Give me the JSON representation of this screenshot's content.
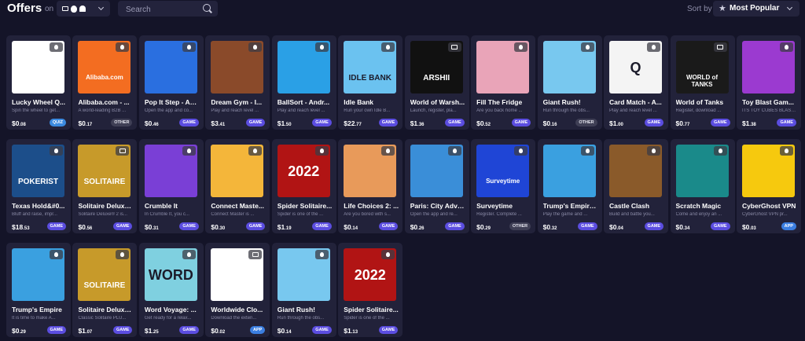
{
  "header": {
    "title": "Offers",
    "on_label": "on",
    "search_placeholder": "Search",
    "sort_label": "Sort by",
    "sort_value": "Most Popular"
  },
  "offers": [
    {
      "name": "Lucky Wheel Q...",
      "desc": "Spin the wheel to get...",
      "price_int": "$0",
      "price_dec": ".08",
      "tag": "QUIZ",
      "platform": "apple",
      "thumb": "lucky-wheel",
      "bg": "#ffffff",
      "thumb_text": ""
    },
    {
      "name": "Alibaba.com - ...",
      "desc": "A world-leading B2B ...",
      "price_int": "$0",
      "price_dec": ".17",
      "tag": "OTHER",
      "platform": "android",
      "thumb": "alibaba",
      "bg": "#f36d21",
      "thumb_text": "Alibaba.com"
    },
    {
      "name": "Pop It Step - An...",
      "desc": "Open the app and co...",
      "price_int": "$0",
      "price_dec": ".46",
      "tag": "GAME",
      "platform": "android",
      "thumb": "pop-it",
      "bg": "#2a6fe0",
      "thumb_text": ""
    },
    {
      "name": "Dream Gym - I...",
      "desc": "Play and reach level ...",
      "price_int": "$3",
      "price_dec": ".41",
      "tag": "GAME",
      "platform": "android",
      "thumb": "dream-gym",
      "bg": "#8a4a2a",
      "thumb_text": ""
    },
    {
      "name": "BallSort - Andr...",
      "desc": "Play and reach level ...",
      "price_int": "$1",
      "price_dec": ".50",
      "tag": "GAME",
      "platform": "android",
      "thumb": "ballsort",
      "bg": "#2aa0e6",
      "thumb_text": ""
    },
    {
      "name": "Idle Bank",
      "desc": "Run your own Idle B...",
      "price_int": "$22",
      "price_dec": ".77",
      "tag": "GAME",
      "platform": "android",
      "thumb": "idle-bank",
      "bg": "#6bc2f0",
      "thumb_text": "IDLE BANK"
    },
    {
      "name": "World of Warsh...",
      "desc": "Launch, register, pla...",
      "price_int": "$1",
      "price_dec": ".36",
      "tag": "GAME",
      "platform": "monitor",
      "thumb": "warships",
      "bg": "#111111",
      "thumb_text": "ARSHII"
    },
    {
      "name": "Fill The Fridge",
      "desc": "Are you back home ...",
      "price_int": "$0",
      "price_dec": ".52",
      "tag": "GAME",
      "platform": "apple",
      "thumb": "fridge",
      "bg": "#e9a4b8",
      "thumb_text": ""
    },
    {
      "name": "Giant Rush!",
      "desc": "Run through the obs...",
      "price_int": "$0",
      "price_dec": ".16",
      "tag": "OTHER",
      "platform": "android",
      "thumb": "giant-rush",
      "bg": "#78c8ef",
      "thumb_text": ""
    },
    {
      "name": "Card Match - A...",
      "desc": "Play and reach level ...",
      "price_int": "$1",
      "price_dec": ".00",
      "tag": "GAME",
      "platform": "android",
      "thumb": "card-match",
      "bg": "#f4f4f4",
      "thumb_text": "Q"
    },
    {
      "name": "World of Tanks",
      "desc": "Register, download ...",
      "price_int": "$0",
      "price_dec": ".77",
      "tag": "GAME",
      "platform": "monitor",
      "thumb": "tanks",
      "bg": "#1a1a1a",
      "thumb_text": "WORLD of TANKS"
    },
    {
      "name": "Toy Blast Gam...",
      "desc": "ITS TOY CUBES BLAST...",
      "price_int": "$1",
      "price_dec": ".38",
      "tag": "GAME",
      "platform": "android",
      "thumb": "toy-blast",
      "bg": "#9b3ad0",
      "thumb_text": ""
    },
    {
      "name": "Texas Hold&#0...",
      "desc": "Bluff and raise, impr...",
      "price_int": "$18",
      "price_dec": ".53",
      "tag": "GAME",
      "platform": "android",
      "thumb": "pokerist",
      "bg": "#1c4e8a",
      "thumb_text": "POKERIST"
    },
    {
      "name": "Solitaire Deluxe...",
      "desc": "Solitaire Deluxe® 2 is...",
      "price_int": "$0",
      "price_dec": ".56",
      "tag": "GAME",
      "platform": "monitor",
      "thumb": "solitaire",
      "bg": "#c79a2a",
      "thumb_text": "SOLITAIRE"
    },
    {
      "name": "Crumble It",
      "desc": "In Crumble It, you c...",
      "price_int": "$0",
      "price_dec": ".31",
      "tag": "GAME",
      "platform": "android",
      "thumb": "crumble",
      "bg": "#7a3fd6",
      "thumb_text": ""
    },
    {
      "name": "Connect Maste...",
      "desc": "Connect Master is ...",
      "price_int": "$0",
      "price_dec": ".30",
      "tag": "GAME",
      "platform": "android",
      "thumb": "connect",
      "bg": "#f4b63a",
      "thumb_text": ""
    },
    {
      "name": "Spider Solitaire...",
      "desc": "Spider is one of the ...",
      "price_int": "$1",
      "price_dec": ".19",
      "tag": "GAME",
      "platform": "android",
      "thumb": "spider",
      "bg": "#b11414",
      "thumb_text": "2022"
    },
    {
      "name": "Life Choices 2: ...",
      "desc": "Are you bored with s...",
      "price_int": "$0",
      "price_dec": ".14",
      "tag": "GAME",
      "platform": "android",
      "thumb": "life-choices",
      "bg": "#e89a5a",
      "thumb_text": ""
    },
    {
      "name": "Paris: City Adve...",
      "desc": "Open the app and re...",
      "price_int": "$0",
      "price_dec": ".26",
      "tag": "GAME",
      "platform": "android",
      "thumb": "paris",
      "bg": "#3a8ed8",
      "thumb_text": ""
    },
    {
      "name": "Surveytime",
      "desc": "Register. Complete ...",
      "price_int": "$0",
      "price_dec": ".29",
      "tag": "OTHER",
      "platform": "apple",
      "thumb": "surveytime",
      "bg": "#1f45d6",
      "thumb_text": "Surveytime"
    },
    {
      "name": "Trump's Empire...",
      "desc": "Play the game and ...",
      "price_int": "$0",
      "price_dec": ".32",
      "tag": "GAME",
      "platform": "android",
      "thumb": "trump",
      "bg": "#3aa0e0",
      "thumb_text": ""
    },
    {
      "name": "Castle Clash",
      "desc": "Build and battle you...",
      "price_int": "$0",
      "price_dec": ".04",
      "tag": "GAME",
      "platform": "android",
      "thumb": "castle",
      "bg": "#8a5a2a",
      "thumb_text": ""
    },
    {
      "name": "Scratch Magic",
      "desc": "Come and enjoy an ...",
      "price_int": "$0",
      "price_dec": ".34",
      "tag": "GAME",
      "platform": "android",
      "thumb": "scratch",
      "bg": "#1a8a8a",
      "thumb_text": ""
    },
    {
      "name": "CyberGhost VPN",
      "desc": "CyberGhost VPN pr...",
      "price_int": "$0",
      "price_dec": ".03",
      "tag": "APP",
      "platform": "apple",
      "thumb": "cyberghost",
      "bg": "#f6c90e",
      "thumb_text": ""
    },
    {
      "name": "Trump's Empire",
      "desc": "It is time to make A...",
      "price_int": "$0",
      "price_dec": ".29",
      "tag": "GAME",
      "platform": "android",
      "thumb": "trump",
      "bg": "#3aa0e0",
      "thumb_text": ""
    },
    {
      "name": "Solitaire Deluxe...",
      "desc": "Classic Solitaire PLU...",
      "price_int": "$1",
      "price_dec": ".07",
      "tag": "GAME",
      "platform": "android",
      "thumb": "solitaire",
      "bg": "#c79a2a",
      "thumb_text": "SOLITAIRE"
    },
    {
      "name": "Word Voyage: ...",
      "desc": "Get ready for a relax...",
      "price_int": "$1",
      "price_dec": ".25",
      "tag": "GAME",
      "platform": "apple",
      "thumb": "word-voyage",
      "bg": "#7fd0e0",
      "thumb_text": "WORD"
    },
    {
      "name": "Worldwide Clo...",
      "desc": "Download the exten...",
      "price_int": "$0",
      "price_dec": ".02",
      "tag": "APP",
      "platform": "monitor",
      "thumb": "clock",
      "bg": "#ffffff",
      "thumb_text": ""
    },
    {
      "name": "Giant Rush!",
      "desc": "Run through the obs...",
      "price_int": "$0",
      "price_dec": ".14",
      "tag": "GAME",
      "platform": "apple",
      "thumb": "giant-rush",
      "bg": "#78c8ef",
      "thumb_text": ""
    },
    {
      "name": "Spider Solitaire...",
      "desc": "Spider is one of the ...",
      "price_int": "$1",
      "price_dec": ".13",
      "tag": "GAME",
      "platform": "apple",
      "thumb": "spider",
      "bg": "#b11414",
      "thumb_text": "2022"
    }
  ]
}
